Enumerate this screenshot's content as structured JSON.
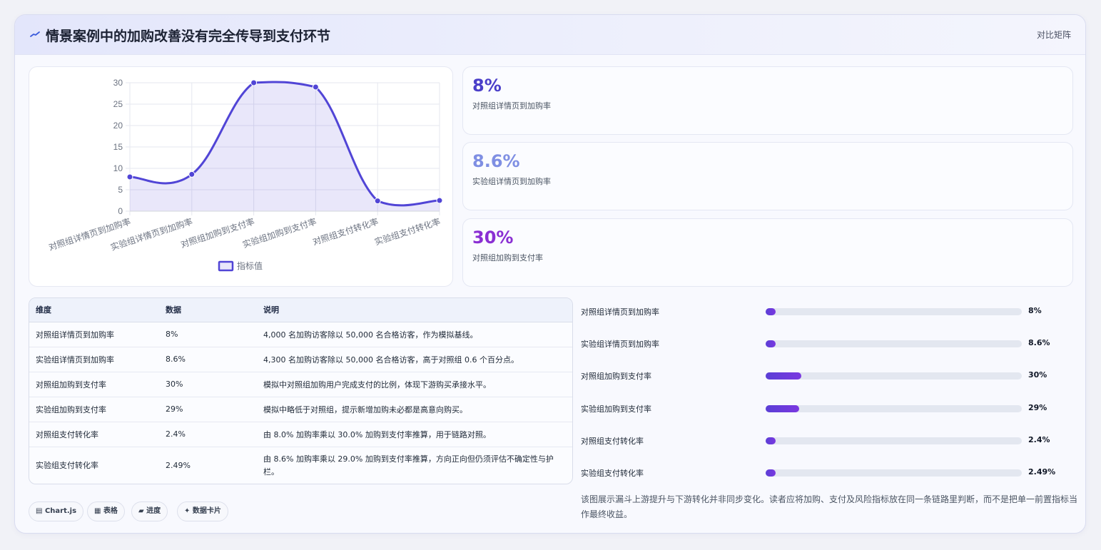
{
  "header": {
    "title": "情景案例中的加购改善没有完全传导到支付环节",
    "badge": "对比矩阵"
  },
  "chart_data": {
    "type": "line",
    "categories": [
      "对照组详情页到加购率",
      "实验组详情页到加购率",
      "对照组加购到支付率",
      "实验组加购到支付率",
      "对照组支付转化率",
      "实验组支付转化率"
    ],
    "series": [
      {
        "name": "指标值",
        "values": [
          8,
          8.6,
          30,
          29,
          2.4,
          2.49
        ]
      }
    ],
    "ylim": [
      0,
      30
    ],
    "yticks": [
      0,
      5,
      10,
      15,
      20,
      25,
      30
    ],
    "grid": true,
    "legend": "bottom",
    "fill": true,
    "color": "#5145d6"
  },
  "kpis": [
    {
      "value": "8%",
      "label": "对照组详情页到加购率",
      "color": "#4b3fc9"
    },
    {
      "value": "8.6%",
      "label": "实验组详情页到加购率",
      "color": "#7f8fe3"
    },
    {
      "value": "30%",
      "label": "对照组加购到支付率",
      "color": "#8a2fd3"
    }
  ],
  "table": {
    "headers": [
      "维度",
      "数据",
      "说明"
    ],
    "rows": [
      [
        "对照组详情页到加购率",
        "8%",
        "4,000 名加购访客除以 50,000 名合格访客，作为模拟基线。"
      ],
      [
        "实验组详情页到加购率",
        "8.6%",
        "4,300 名加购访客除以 50,000 名合格访客，高于对照组 0.6 个百分点。"
      ],
      [
        "对照组加购到支付率",
        "30%",
        "模拟中对照组加购用户完成支付的比例，体现下游购买承接水平。"
      ],
      [
        "实验组加购到支付率",
        "29%",
        "模拟中略低于对照组，提示新增加购未必都是高意向购买。"
      ],
      [
        "对照组支付转化率",
        "2.4%",
        "由 8.0% 加购率乘以 30.0% 加购到支付率推算，用于链路对照。"
      ],
      [
        "实验组支付转化率",
        "2.49%",
        "由 8.6% 加购率乘以 29.0% 加购到支付率推算，方向正向但仍须评估不确定性与护栏。"
      ]
    ]
  },
  "progress": [
    {
      "label": "对照组详情页到加购率",
      "value": "8%",
      "fraction": 0.04
    },
    {
      "label": "实验组详情页到加购率",
      "value": "8.6%",
      "fraction": 0.04
    },
    {
      "label": "对照组加购到支付率",
      "value": "30%",
      "fraction": 0.14
    },
    {
      "label": "实验组加购到支付率",
      "value": "29%",
      "fraction": 0.13
    },
    {
      "label": "对照组支付转化率",
      "value": "2.4%",
      "fraction": 0.04
    },
    {
      "label": "实验组支付转化率",
      "value": "2.49%",
      "fraction": 0.04
    }
  ],
  "pills": [
    "Chart.js",
    "表格",
    "进度",
    "数据卡片"
  ],
  "note": "该图展示漏斗上游提升与下游转化并非同步变化。读者应将加购、支付及风险指标放在同一条链路里判断，而不是把单一前置指标当作最终收益。"
}
